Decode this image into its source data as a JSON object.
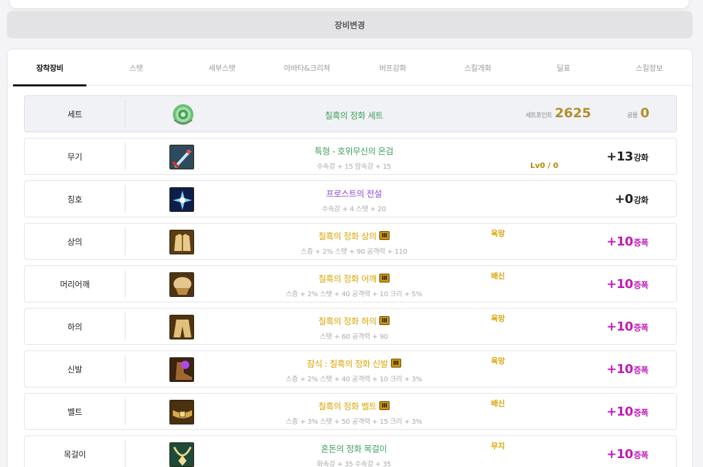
{
  "change_button": "장비변경",
  "tabs": [
    {
      "label": "장착장비",
      "active": true
    },
    {
      "label": "스탯",
      "active": false
    },
    {
      "label": "세부스탯",
      "active": false
    },
    {
      "label": "아바타&크리쳐",
      "active": false
    },
    {
      "label": "버프강화",
      "active": false
    },
    {
      "label": "스킬개화",
      "active": false
    },
    {
      "label": "딜표",
      "active": false
    },
    {
      "label": "스킬정보",
      "active": false
    }
  ],
  "set": {
    "slot": "세트",
    "name": "칠흑의 정화 세트",
    "points_label": "세트포인트",
    "points": "2625",
    "common_label": "공용",
    "common": "0",
    "icon": "rose-emblem-icon"
  },
  "items": [
    {
      "slot": "무기",
      "name": "특형 - 호위무신의 온검",
      "name_color": "#3e9f5a",
      "badge": "",
      "stat": "수속강 + 15 암속강 + 15",
      "emblem": "",
      "level": "Lv0 / 0",
      "enh_value": "+13",
      "enh_suffix": "강화",
      "enh_color": "#222222",
      "icon": "sword-icon"
    },
    {
      "slot": "칭호",
      "name": "프로스트의 전설",
      "name_color": "#8a48d8",
      "badge": "",
      "stat": "수속강 + 4 스탯 + 20",
      "emblem": "",
      "level": "",
      "enh_value": "+0",
      "enh_suffix": "강화",
      "enh_color": "#222222",
      "icon": "frost-title-icon"
    },
    {
      "slot": "상의",
      "name": "칠흑의 정화 상의",
      "name_color": "#d9a400",
      "badge": "III",
      "stat": "스증 + 2% 스탯 + 90 공격력 + 110",
      "emblem": "욕망",
      "level": "",
      "enh_value": "+10",
      "enh_suffix": "증폭",
      "enh_color": "#c21ab8",
      "icon": "top-armor-icon"
    },
    {
      "slot": "머리어깨",
      "name": "칠흑의 정화 어깨",
      "name_color": "#d9a400",
      "badge": "III",
      "stat": "스증 + 2% 스탯 + 40 공격력 + 10 크리 + 5%",
      "emblem": "배신",
      "level": "",
      "enh_value": "+10",
      "enh_suffix": "증폭",
      "enh_color": "#c21ab8",
      "icon": "shoulder-armor-icon"
    },
    {
      "slot": "하의",
      "name": "칠흑의 정화 하의",
      "name_color": "#d9a400",
      "badge": "III",
      "stat": "스탯 + 60 공격력 + 90",
      "emblem": "욕망",
      "level": "",
      "enh_value": "+10",
      "enh_suffix": "증폭",
      "enh_color": "#c21ab8",
      "icon": "pants-armor-icon"
    },
    {
      "slot": "신발",
      "name": "잠식 : 칠흑의 정화 신발",
      "name_color": "#d9a400",
      "badge": "III",
      "stat": "스증 + 2% 스탯 + 40 공격력 + 10 크리 + 3%",
      "emblem": "욕망",
      "level": "",
      "enh_value": "+10",
      "enh_suffix": "증폭",
      "enh_color": "#c21ab8",
      "icon": "shoes-armor-icon"
    },
    {
      "slot": "벨트",
      "name": "칠흑의 정화 벨트",
      "name_color": "#d9a400",
      "badge": "III",
      "stat": "스증 + 3% 스탯 + 50 공격력 + 15 크리 + 3%",
      "emblem": "배신",
      "level": "",
      "enh_value": "+10",
      "enh_suffix": "증폭",
      "enh_color": "#c21ab8",
      "icon": "belt-armor-icon"
    },
    {
      "slot": "목걸이",
      "name": "혼돈의 정화 목걸이",
      "name_color": "#3e9f5a",
      "badge": "",
      "stat": "화속강 + 35 수속강 + 35",
      "emblem": "무지",
      "level": "",
      "enh_value": "+10",
      "enh_suffix": "증폭",
      "enh_color": "#c21ab8",
      "icon": "necklace-icon"
    }
  ]
}
